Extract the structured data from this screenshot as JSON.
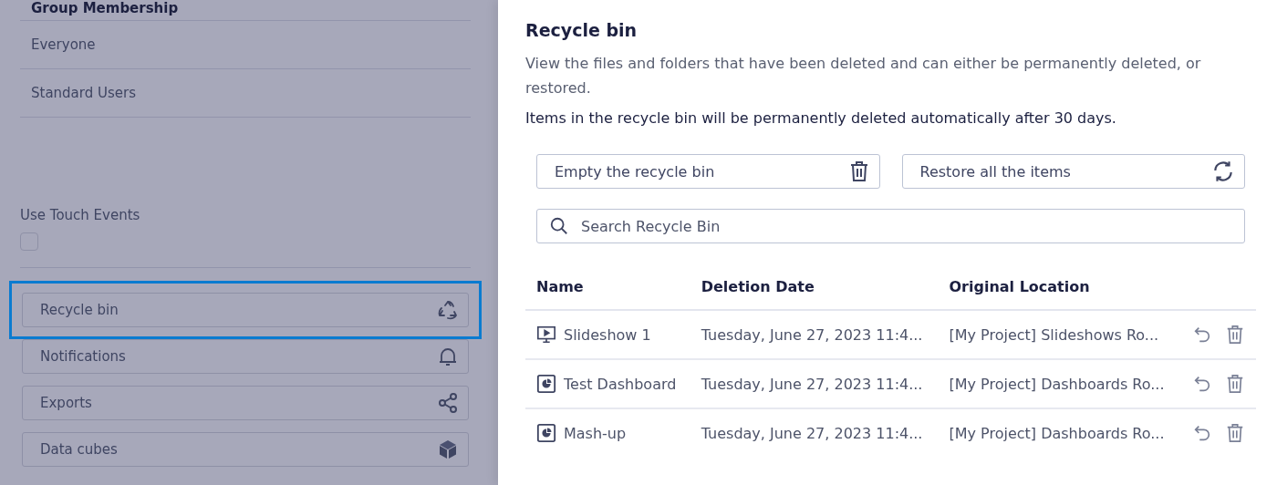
{
  "sidebar": {
    "group_heading": "Group Membership",
    "groups": [
      "Everyone",
      "Standard Users"
    ],
    "touch_events": {
      "label": "Use Touch Events",
      "checked": false
    },
    "buttons": [
      {
        "label": "Recycle bin",
        "kind": "recycle",
        "selected": true
      },
      {
        "label": "Notifications",
        "kind": "bell",
        "selected": false
      },
      {
        "label": "Exports",
        "kind": "share",
        "selected": false
      },
      {
        "label": "Data cubes",
        "kind": "cube",
        "selected": false
      }
    ]
  },
  "panel": {
    "title": "Recycle bin",
    "description": "View the files and folders that have been deleted and can either be permanently deleted, or restored.",
    "note": "Items in the recycle bin will be permanently deleted automatically after 30 days.",
    "actions": [
      {
        "label": "Empty the recycle bin",
        "kind": "trash"
      },
      {
        "label": "Restore all the items",
        "kind": "refresh"
      }
    ],
    "search": {
      "placeholder": "Search Recycle Bin"
    },
    "table": {
      "columns": [
        "Name",
        "Deletion Date",
        "Original Location"
      ],
      "rows": [
        {
          "kind": "slideshow",
          "name": "Slideshow 1",
          "date": "Tuesday, June 27, 2023 11:4...",
          "location": "[My Project] Slideshows Ro..."
        },
        {
          "kind": "dashboard",
          "name": "Test Dashboard",
          "date": "Tuesday, June 27, 2023 11:4...",
          "location": "[My Project] Dashboards Ro..."
        },
        {
          "kind": "dashboard",
          "name": "Mash-up",
          "date": "Tuesday, June 27, 2023 11:4...",
          "location": "[My Project] Dashboards Ro..."
        }
      ]
    }
  }
}
